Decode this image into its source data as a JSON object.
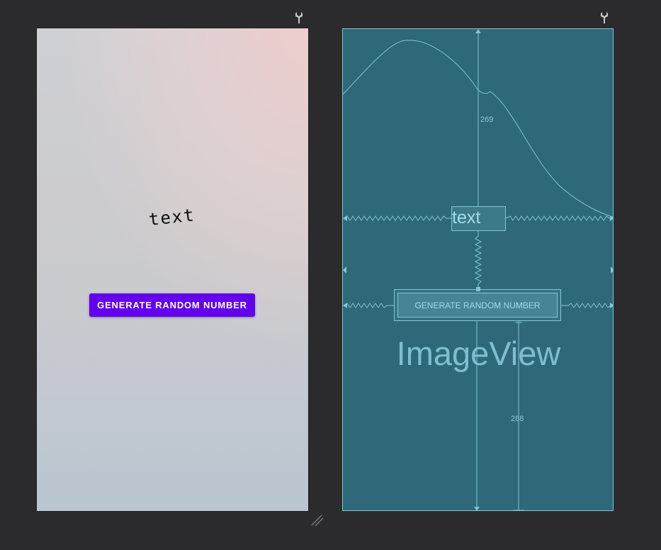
{
  "design": {
    "text_view": "text",
    "button_label": "GENERATE RANDOM NUMBER"
  },
  "blueprint": {
    "text_view": "text",
    "button_label": "GENERATE RANDOM NUMBER",
    "image_view_label": "ImageView",
    "top_margin": "269",
    "bottom_margin": "288"
  },
  "icons": {
    "left_toolbar": "wrench-icon",
    "right_toolbar": "wrench-icon",
    "resize": "resize-handle-icon"
  },
  "colors": {
    "editor_bg": "#2b2b2d",
    "button_primary": "#6200ee",
    "blueprint_bg": "#2f6878",
    "blueprint_line": "#7fc6d6"
  }
}
